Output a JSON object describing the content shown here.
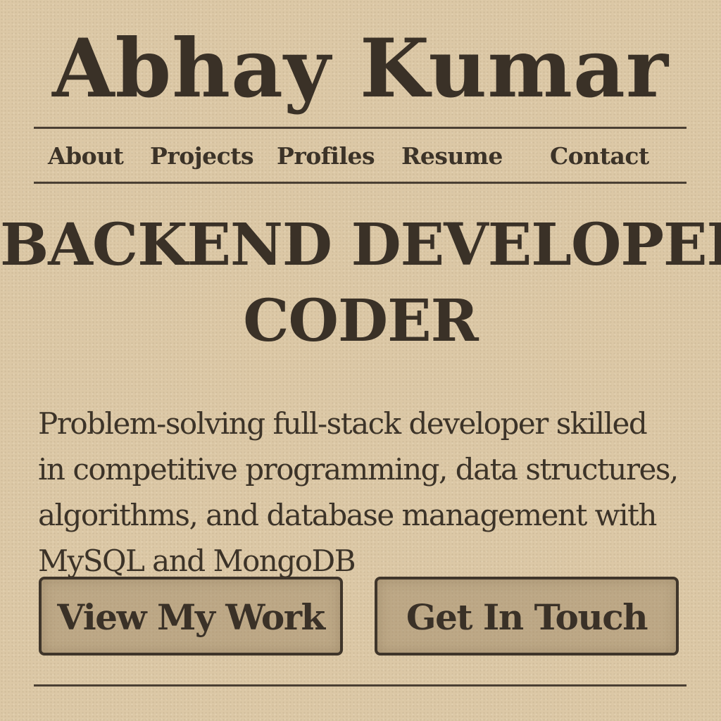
{
  "header": {
    "name": "Abhay Kumar"
  },
  "nav": {
    "items": [
      {
        "label": "About"
      },
      {
        "label": "Projects"
      },
      {
        "label": "Profiles"
      },
      {
        "label": "Resume"
      },
      {
        "label": "Contact"
      }
    ]
  },
  "hero": {
    "headline_line1": "BACKEND DEVELOPER",
    "headline_line2": "CODER",
    "bio_lines": [
      "Problem-solving full-stack developer skilled",
      "in competitive programming, data structures,",
      "algorithms, and database management with",
      "MySQL and MongoDB"
    ]
  },
  "actions": {
    "primary_label": "View My Work",
    "secondary_label": "Get In Touch"
  },
  "colors": {
    "paper": "#dcc8a6",
    "ink": "#3a3127",
    "button_fill": "#a8916c"
  }
}
